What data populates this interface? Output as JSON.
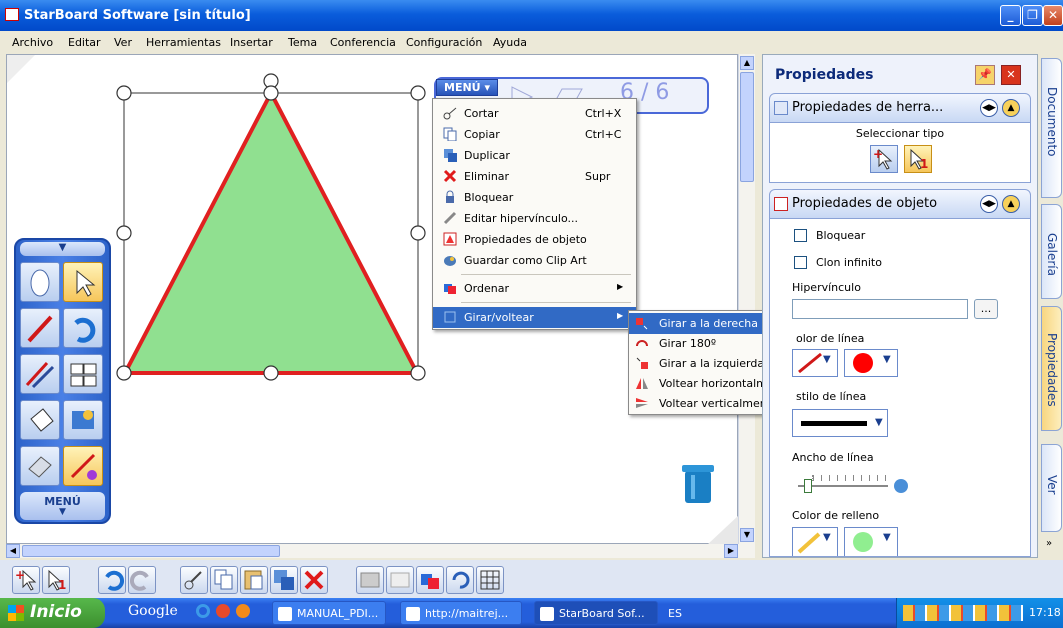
{
  "window": {
    "title": "StarBoard Software [sin título]"
  },
  "menubar": [
    "Archivo",
    "Editar",
    "Ver",
    "Herramientas",
    "Insertar",
    "Tema",
    "Conferencia",
    "Configuración",
    "Ayuda"
  ],
  "pagebar": {
    "menu_label": "MENÚ",
    "page": "6 / 6"
  },
  "toolpanel": {
    "menu_label": "MENÚ"
  },
  "context_menu": {
    "items": [
      {
        "label": "Cortar",
        "shortcut": "Ctrl+X",
        "icon": "scissors-icon"
      },
      {
        "label": "Copiar",
        "shortcut": "Ctrl+C",
        "icon": "copy-icon"
      },
      {
        "label": "Duplicar",
        "shortcut": "",
        "icon": "duplicate-icon"
      },
      {
        "label": "Eliminar",
        "shortcut": "Supr",
        "icon": "delete-x-icon"
      },
      {
        "label": "Bloquear",
        "shortcut": "",
        "icon": "lock-icon"
      },
      {
        "label": "Editar hipervínculo...",
        "shortcut": "",
        "icon": "link-icon"
      },
      {
        "label": "Propiedades de objeto",
        "shortcut": "",
        "icon": "properties-icon"
      },
      {
        "label": "Guardar como Clip Art",
        "shortcut": "",
        "icon": "clipart-icon"
      },
      {
        "label": "Ordenar",
        "shortcut": "",
        "icon": "order-icon"
      },
      {
        "label": "Girar/voltear",
        "shortcut": "",
        "icon": "rotate-icon"
      }
    ]
  },
  "submenu": {
    "items": [
      {
        "label": "Girar a la derecha",
        "icon": "rotate-right-icon"
      },
      {
        "label": "Girar 180º",
        "icon": "rotate-180-icon"
      },
      {
        "label": "Girar a la izquierda",
        "icon": "rotate-left-icon"
      },
      {
        "label": "Voltear horizontalmente",
        "icon": "flip-horizontal-icon"
      },
      {
        "label": "Voltear verticalmente",
        "icon": "flip-vertical-icon"
      }
    ]
  },
  "properties": {
    "title": "Propiedades",
    "tool_props": {
      "title": "Propiedades de herra...",
      "select_type": "Seleccionar tipo"
    },
    "object_props": {
      "title": "Propiedades de objeto",
      "lock_label": "Bloquear",
      "infinite_clone_label": "Clon infinito",
      "hyperlink_label": "Hipervínculo",
      "hyperlink_value": "",
      "browse_label": "...",
      "line_color_label": "olor de línea",
      "line_style_label": "stilo de línea",
      "line_width_label": "Ancho de línea",
      "fill_color_label": "Color de relleno",
      "line_color": "#ff0000",
      "fill_color": "#90ee90"
    }
  },
  "side_tabs": [
    "Documento",
    "Galería",
    "Propiedades",
    "Ver"
  ],
  "shape": {
    "type": "triangle",
    "fill": "#90e090",
    "stroke": "#e02020"
  },
  "taskbar": {
    "start_label": "Inicio",
    "google_label": "Google",
    "tasks": [
      "MANUAL_PDI...",
      "http://maitrej...",
      "StarBoard Sof..."
    ],
    "lang": "ES",
    "clock": "17:18"
  }
}
